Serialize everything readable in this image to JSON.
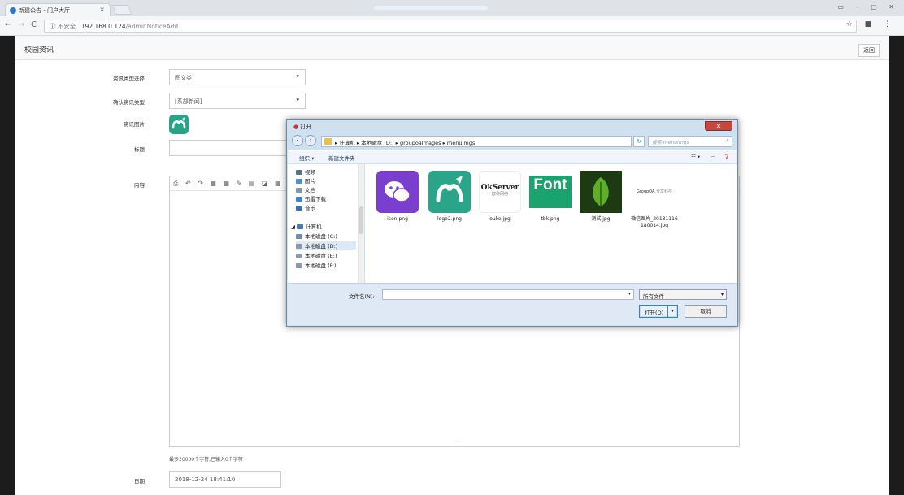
{
  "browser": {
    "tab_title": "新建公告 - 门户大厅",
    "tab_close": "×",
    "url_insecure": "不安全",
    "url_host": "192.168.0.124",
    "url_path": "/adminNoticeAdd"
  },
  "page": {
    "title": "校园资讯",
    "back_label": "返回",
    "fields": {
      "type_select_label": "资讯类型选择",
      "type_select_value": "图文类",
      "confirm_type_label": "确认资讯类型",
      "confirm_type_value": "[系部新闻]",
      "image_label": "资讯图片",
      "title_label": "标题",
      "content_label": "内容",
      "date_label": "日期",
      "date_value": "2018-12-24 18:41:10"
    },
    "editor_hint": "最多20000个字符,已输入0个字符"
  },
  "dialog": {
    "title": "打开",
    "close": "✕",
    "breadcrumb": "▸ 计算机 ▸ 本地磁盘 (D:) ▸ groupoaImages ▸ menuImgs",
    "search_placeholder": "搜索 menuImgs",
    "organize": "组织 ▾",
    "new_folder": "新建文件夹",
    "nav_items": [
      {
        "label": "视频",
        "color": "#5b6f86"
      },
      {
        "label": "图片",
        "color": "#4f8fcf"
      },
      {
        "label": "文档",
        "color": "#7f96b0"
      },
      {
        "label": "迅雷下载",
        "color": "#3d83d6"
      },
      {
        "label": "音乐",
        "color": "#3b6fb0"
      },
      {
        "label": "计算机",
        "color": "#4a7bb8"
      },
      {
        "label": "本地磁盘 (C:)",
        "color": "#6f8aa8"
      },
      {
        "label": "本地磁盘 (D:)",
        "color": "#8a9aab"
      },
      {
        "label": "本地磁盘 (E:)",
        "color": "#8a9aab"
      },
      {
        "label": "本地磁盘 (F:)",
        "color": "#8a9aab"
      }
    ],
    "files": [
      {
        "name": "icon.png"
      },
      {
        "name": "logo2.png"
      },
      {
        "name": "ouke.jpg",
        "text": "OkServer",
        "subtext": "欧科网络"
      },
      {
        "name": "tbk.png",
        "text": "Font"
      },
      {
        "name": "测试.jpg"
      },
      {
        "name": "微信图片_20181116180014.jpg",
        "text": "GroupOA",
        "subtext": "分享科技"
      }
    ],
    "filename_label": "文件名(N):",
    "filetype_value": "所有文件",
    "open_label": "打开(O)",
    "cancel_label": "取消"
  }
}
